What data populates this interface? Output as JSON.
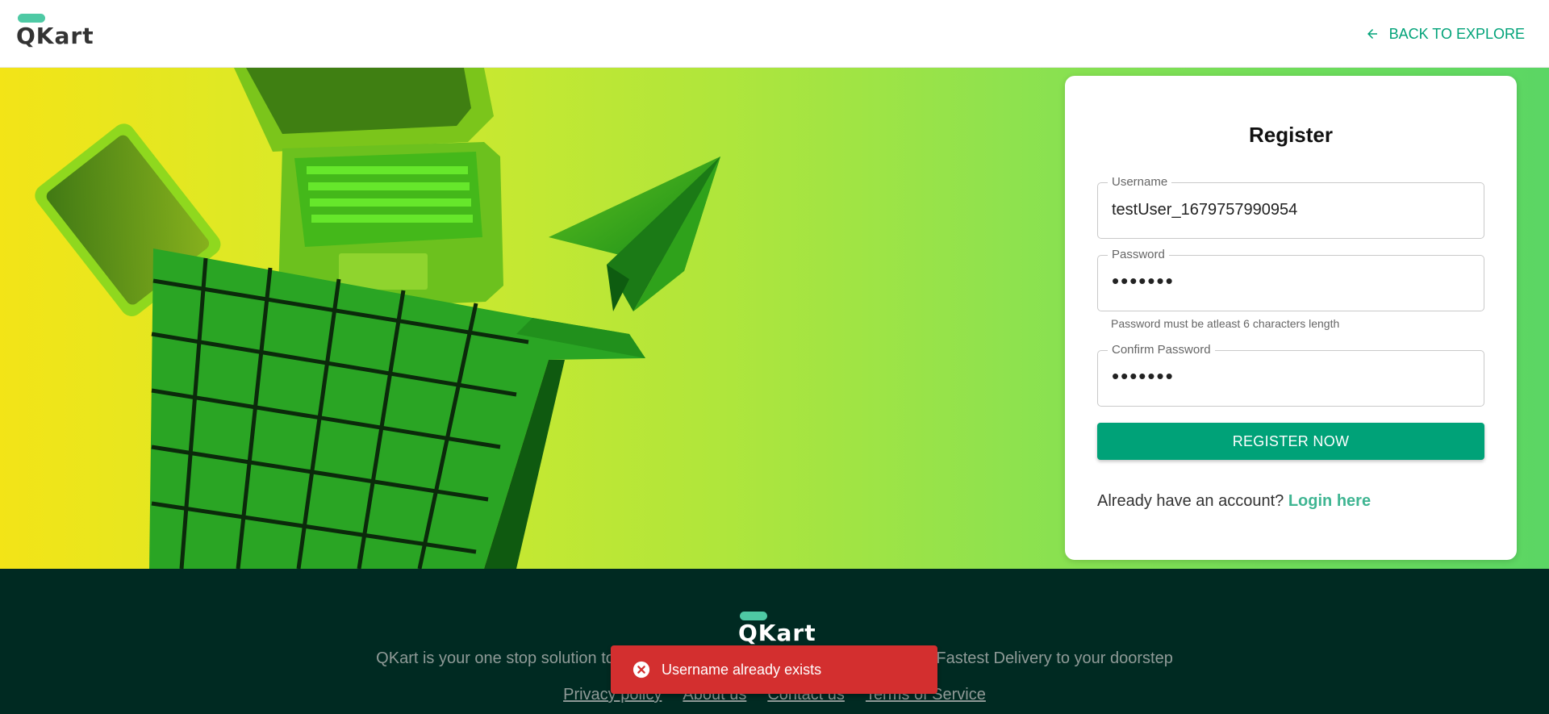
{
  "header": {
    "logo": "QKart",
    "back_label": "BACK TO EXPLORE"
  },
  "register": {
    "title": "Register",
    "username": {
      "label": "Username",
      "value": "testUser_1679757990954"
    },
    "password": {
      "label": "Password",
      "value": "•••••••"
    },
    "password_helper": "Password must be atleast 6 characters length",
    "confirm_password": {
      "label": "Confirm Password",
      "value": "•••••••"
    },
    "button_label": "REGISTER NOW",
    "login_prompt": "Already have an account?",
    "login_link": "Login here"
  },
  "footer": {
    "logo": "QKart",
    "tagline": "QKart is your one stop solution to the buy the latest trending items with India's Fastest Delivery to your doorstep",
    "links": [
      "Privacy policy",
      "About us",
      "Contact us",
      "Terms of Service"
    ]
  },
  "snackbar": {
    "message": "Username already exists"
  },
  "colors": {
    "accent": "#00a278",
    "logo_pill": "#4ec9a4",
    "footer_bg": "#002a22",
    "error": "#d32f2f"
  },
  "icons": {
    "back": "arrow-left-icon",
    "error": "close-circle-icon"
  }
}
